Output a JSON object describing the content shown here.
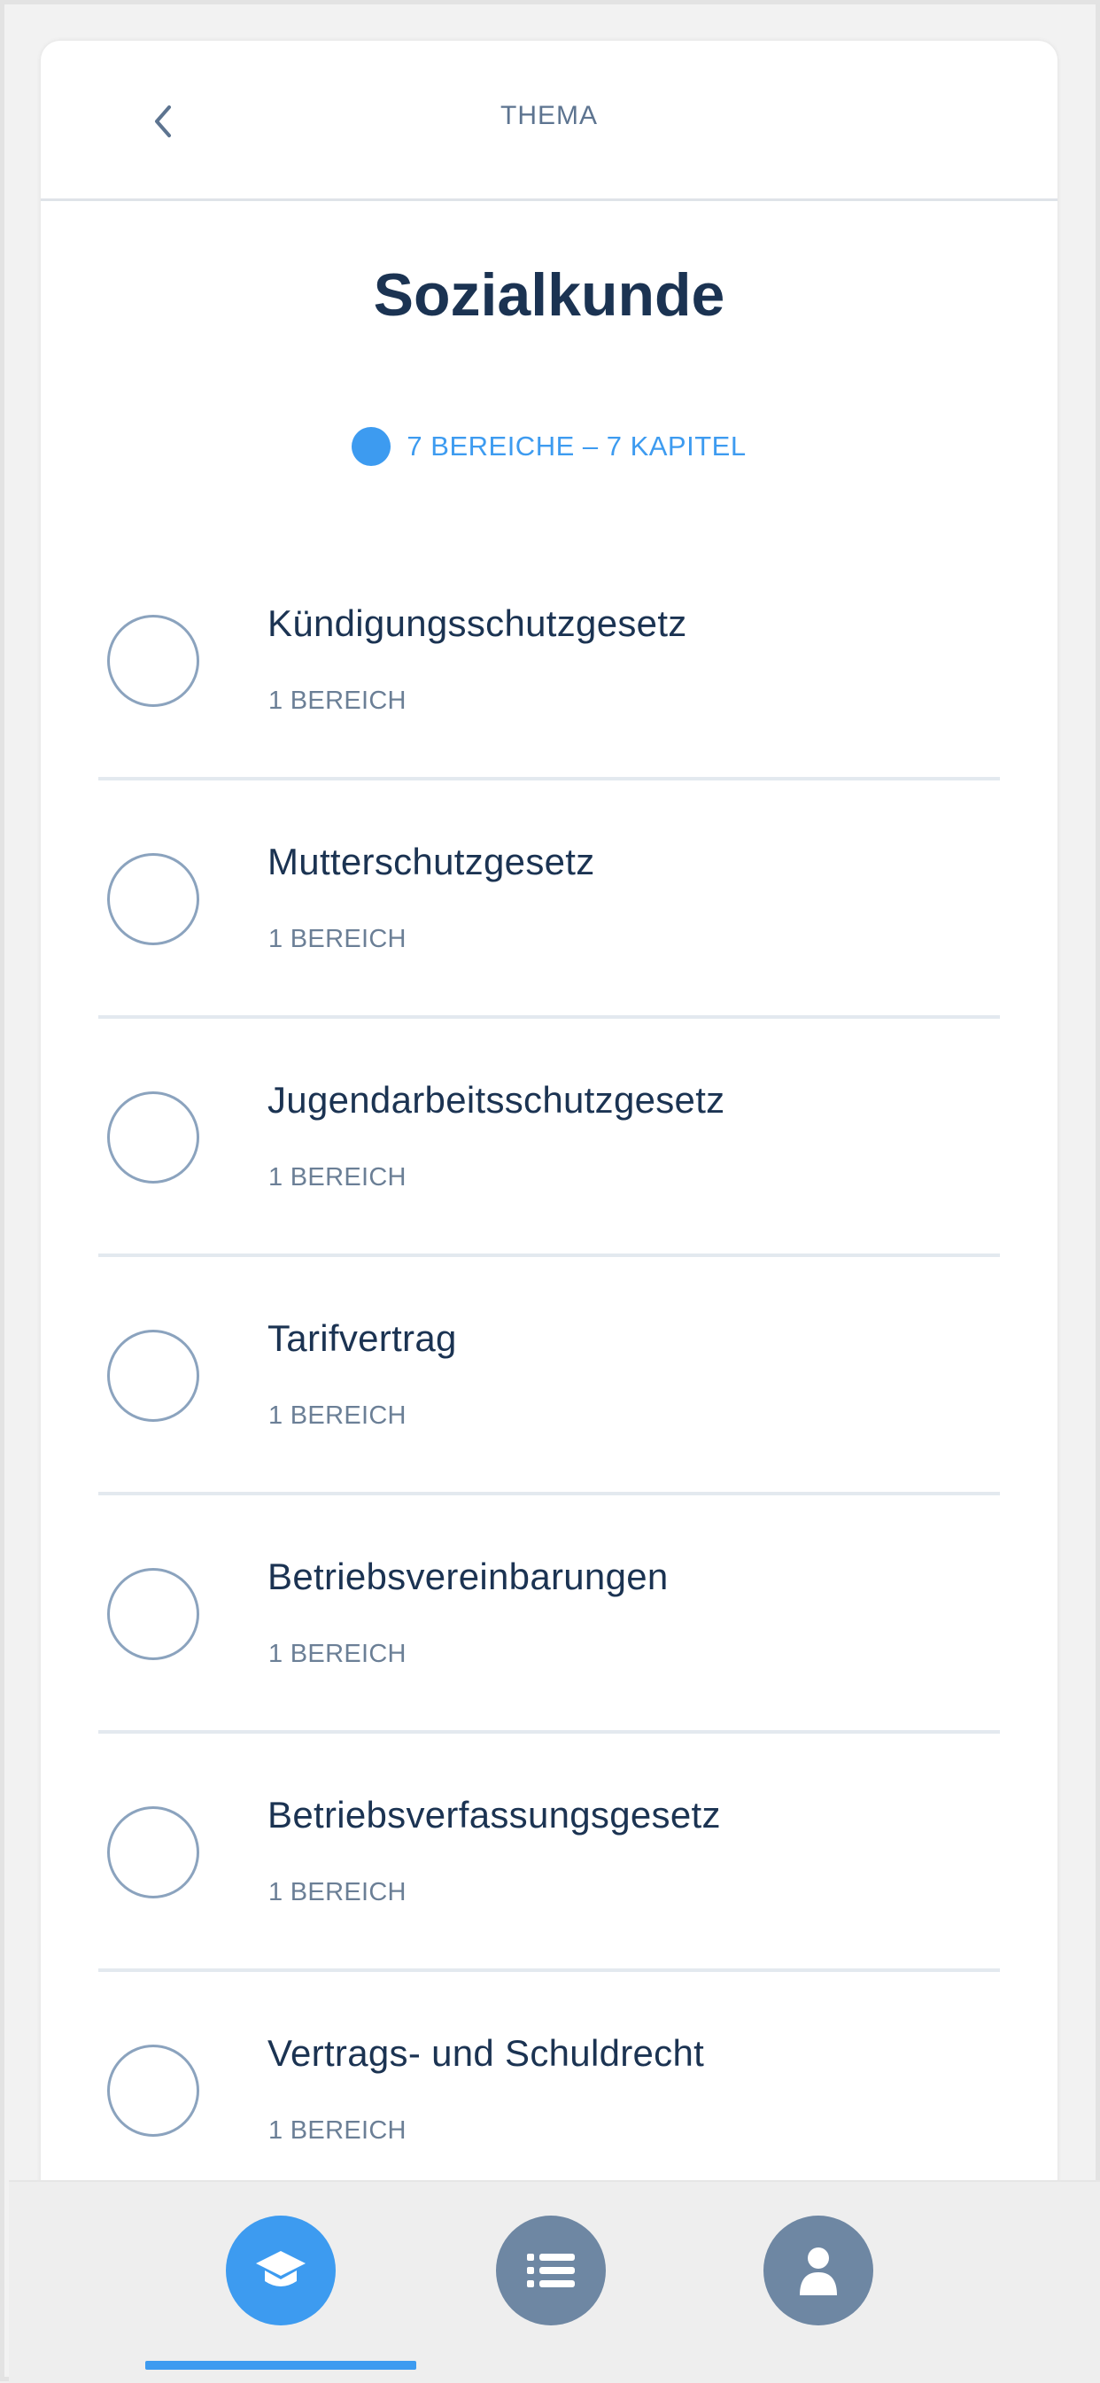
{
  "header": {
    "title": "THEMA",
    "back_icon": "chevron-left-icon"
  },
  "page": {
    "title": "Sozialkunde",
    "meta": "7 BEREICHE – 7 KAPITEL"
  },
  "items": [
    {
      "title": "Kündigungsschutzgesetz",
      "subtitle": "1 BEREICH"
    },
    {
      "title": "Mutterschutzgesetz",
      "subtitle": "1 BEREICH"
    },
    {
      "title": "Jugendarbeitsschutzgesetz",
      "subtitle": "1 BEREICH"
    },
    {
      "title": "Tarifvertrag",
      "subtitle": "1 BEREICH"
    },
    {
      "title": "Betriebsvereinbarungen",
      "subtitle": "1 BEREICH"
    },
    {
      "title": "Betriebsverfassungsgesetz",
      "subtitle": "1 BEREICH"
    },
    {
      "title": "Vertrags- und Schuldrecht",
      "subtitle": "1 BEREICH"
    }
  ],
  "tabbar": {
    "tabs": [
      {
        "icon": "graduation-cap-icon",
        "active": true
      },
      {
        "icon": "list-icon",
        "active": false
      },
      {
        "icon": "user-icon",
        "active": false
      }
    ]
  },
  "colors": {
    "accent": "#3d9bf0",
    "title": "#1b3352",
    "muted": "#6b7f96",
    "tab_inactive": "#6e87a3"
  }
}
